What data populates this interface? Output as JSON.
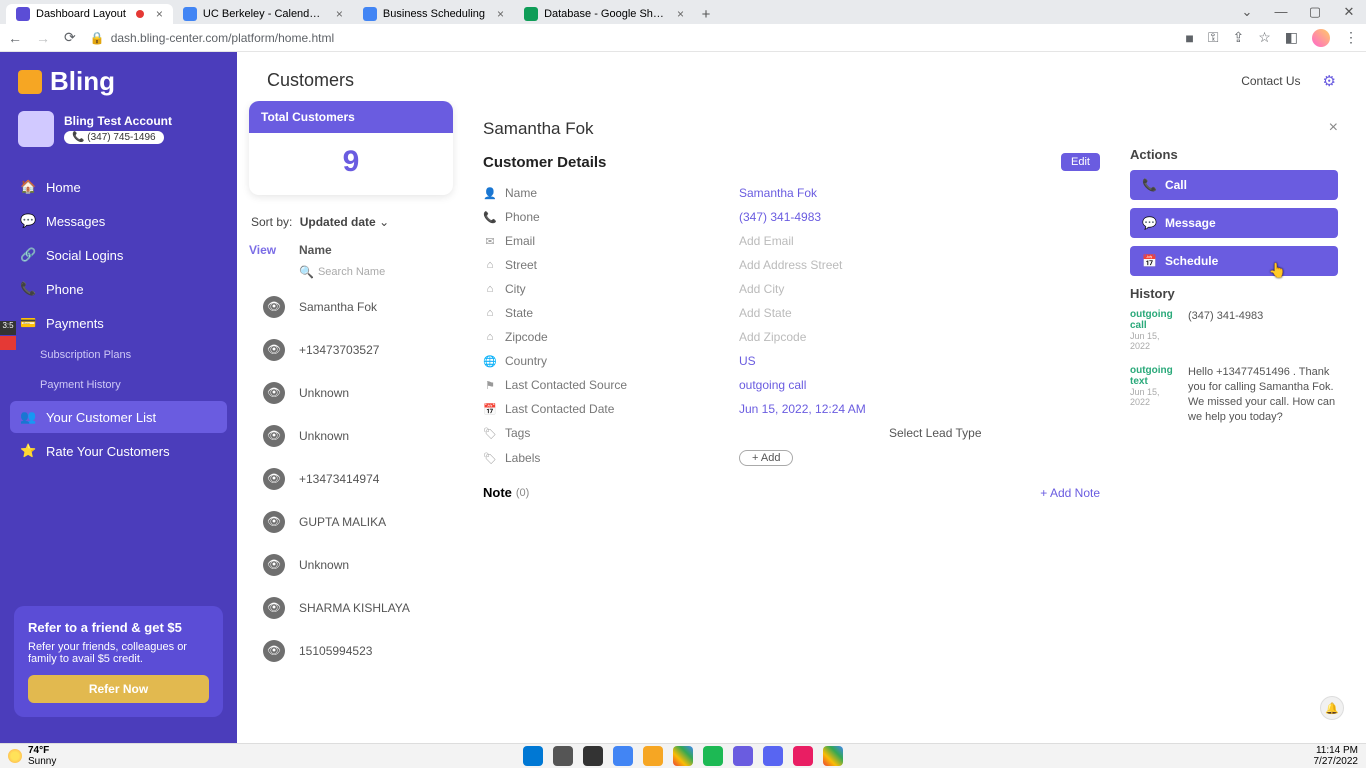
{
  "browser": {
    "tabs": [
      {
        "title": "Dashboard Layout",
        "recording": true,
        "active": true
      },
      {
        "title": "UC Berkeley - Calendar - Week o"
      },
      {
        "title": "Business Scheduling"
      },
      {
        "title": "Database - Google Sheets"
      }
    ],
    "url": "dash.bling-center.com/platform/home.html"
  },
  "brand": "Bling",
  "account": {
    "name": "Bling Test Account",
    "phone": "(347) 745-1496"
  },
  "nav": {
    "items": [
      {
        "icon": "🏠",
        "label": "Home"
      },
      {
        "icon": "💬",
        "label": "Messages"
      },
      {
        "icon": "🔗",
        "label": "Social Logins"
      },
      {
        "icon": "📞",
        "label": "Phone"
      },
      {
        "icon": "💳",
        "label": "Payments"
      }
    ],
    "subs": [
      {
        "label": "Subscription Plans"
      },
      {
        "label": "Payment History"
      }
    ],
    "active": {
      "icon": "👥",
      "label": "Your Customer List"
    },
    "after": {
      "icon": "⭐",
      "label": "Rate Your Customers"
    }
  },
  "refer": {
    "title": "Refer to a friend & get $5",
    "body": "Refer your friends, colleagues or family to avail $5 credit.",
    "button": "Refer Now"
  },
  "top": {
    "heading": "Customers",
    "contact": "Contact Us"
  },
  "totalCard": {
    "label": "Total Customers",
    "value": "9"
  },
  "sort": {
    "label": "Sort by:",
    "value": "Updated date"
  },
  "listHead": {
    "view": "View",
    "name": "Name"
  },
  "searchPlaceholder": "Search Name",
  "customers": [
    "Samantha Fok",
    "+13473703527",
    "Unknown",
    "Unknown",
    "+13473414974",
    "GUPTA MALIKA",
    "Unknown",
    "SHARMA KISHLAYA",
    "15105994523"
  ],
  "detail": {
    "name": "Samantha Fok",
    "sectionTitle": "Customer Details",
    "edit": "Edit",
    "fields": {
      "name": {
        "label": "Name",
        "value": "Samantha Fok",
        "ph": false
      },
      "phone": {
        "label": "Phone",
        "value": "(347) 341-4983",
        "ph": false
      },
      "email": {
        "label": "Email",
        "value": "Add Email",
        "ph": true
      },
      "street": {
        "label": "Street",
        "value": "Add Address Street",
        "ph": true
      },
      "city": {
        "label": "City",
        "value": "Add City",
        "ph": true
      },
      "state": {
        "label": "State",
        "value": "Add State",
        "ph": true
      },
      "zip": {
        "label": "Zipcode",
        "value": "Add Zipcode",
        "ph": true
      },
      "country": {
        "label": "Country",
        "value": "US",
        "ph": false
      },
      "src": {
        "label": "Last Contacted Source",
        "value": "outgoing call",
        "ph": false
      },
      "date": {
        "label": "Last Contacted Date",
        "value": "Jun 15, 2022, 12:24 AM",
        "ph": false
      },
      "tags": {
        "label": "Tags",
        "value": "Select Lead Type",
        "dark": true
      },
      "labels": {
        "label": "Labels",
        "value": "+ Add",
        "pill": true
      }
    },
    "note": {
      "label": "Note",
      "count": "(0)",
      "add": "+ Add Note"
    }
  },
  "actions": {
    "title": "Actions",
    "call": "Call",
    "message": "Message",
    "schedule": "Schedule",
    "historyTitle": "History",
    "history": [
      {
        "tag": "outgoing call",
        "date": "Jun 15, 2022",
        "body": "(347) 341-4983"
      },
      {
        "tag": "outgoing text",
        "date": "Jun 15, 2022",
        "body": "Hello +13477451496 . Thank you for calling Samantha Fok. We missed your call. How can we help you today?"
      }
    ]
  },
  "taskbar": {
    "temp": "74°F",
    "cond": "Sunny",
    "time": "11:14 PM",
    "date": "7/27/2022"
  }
}
